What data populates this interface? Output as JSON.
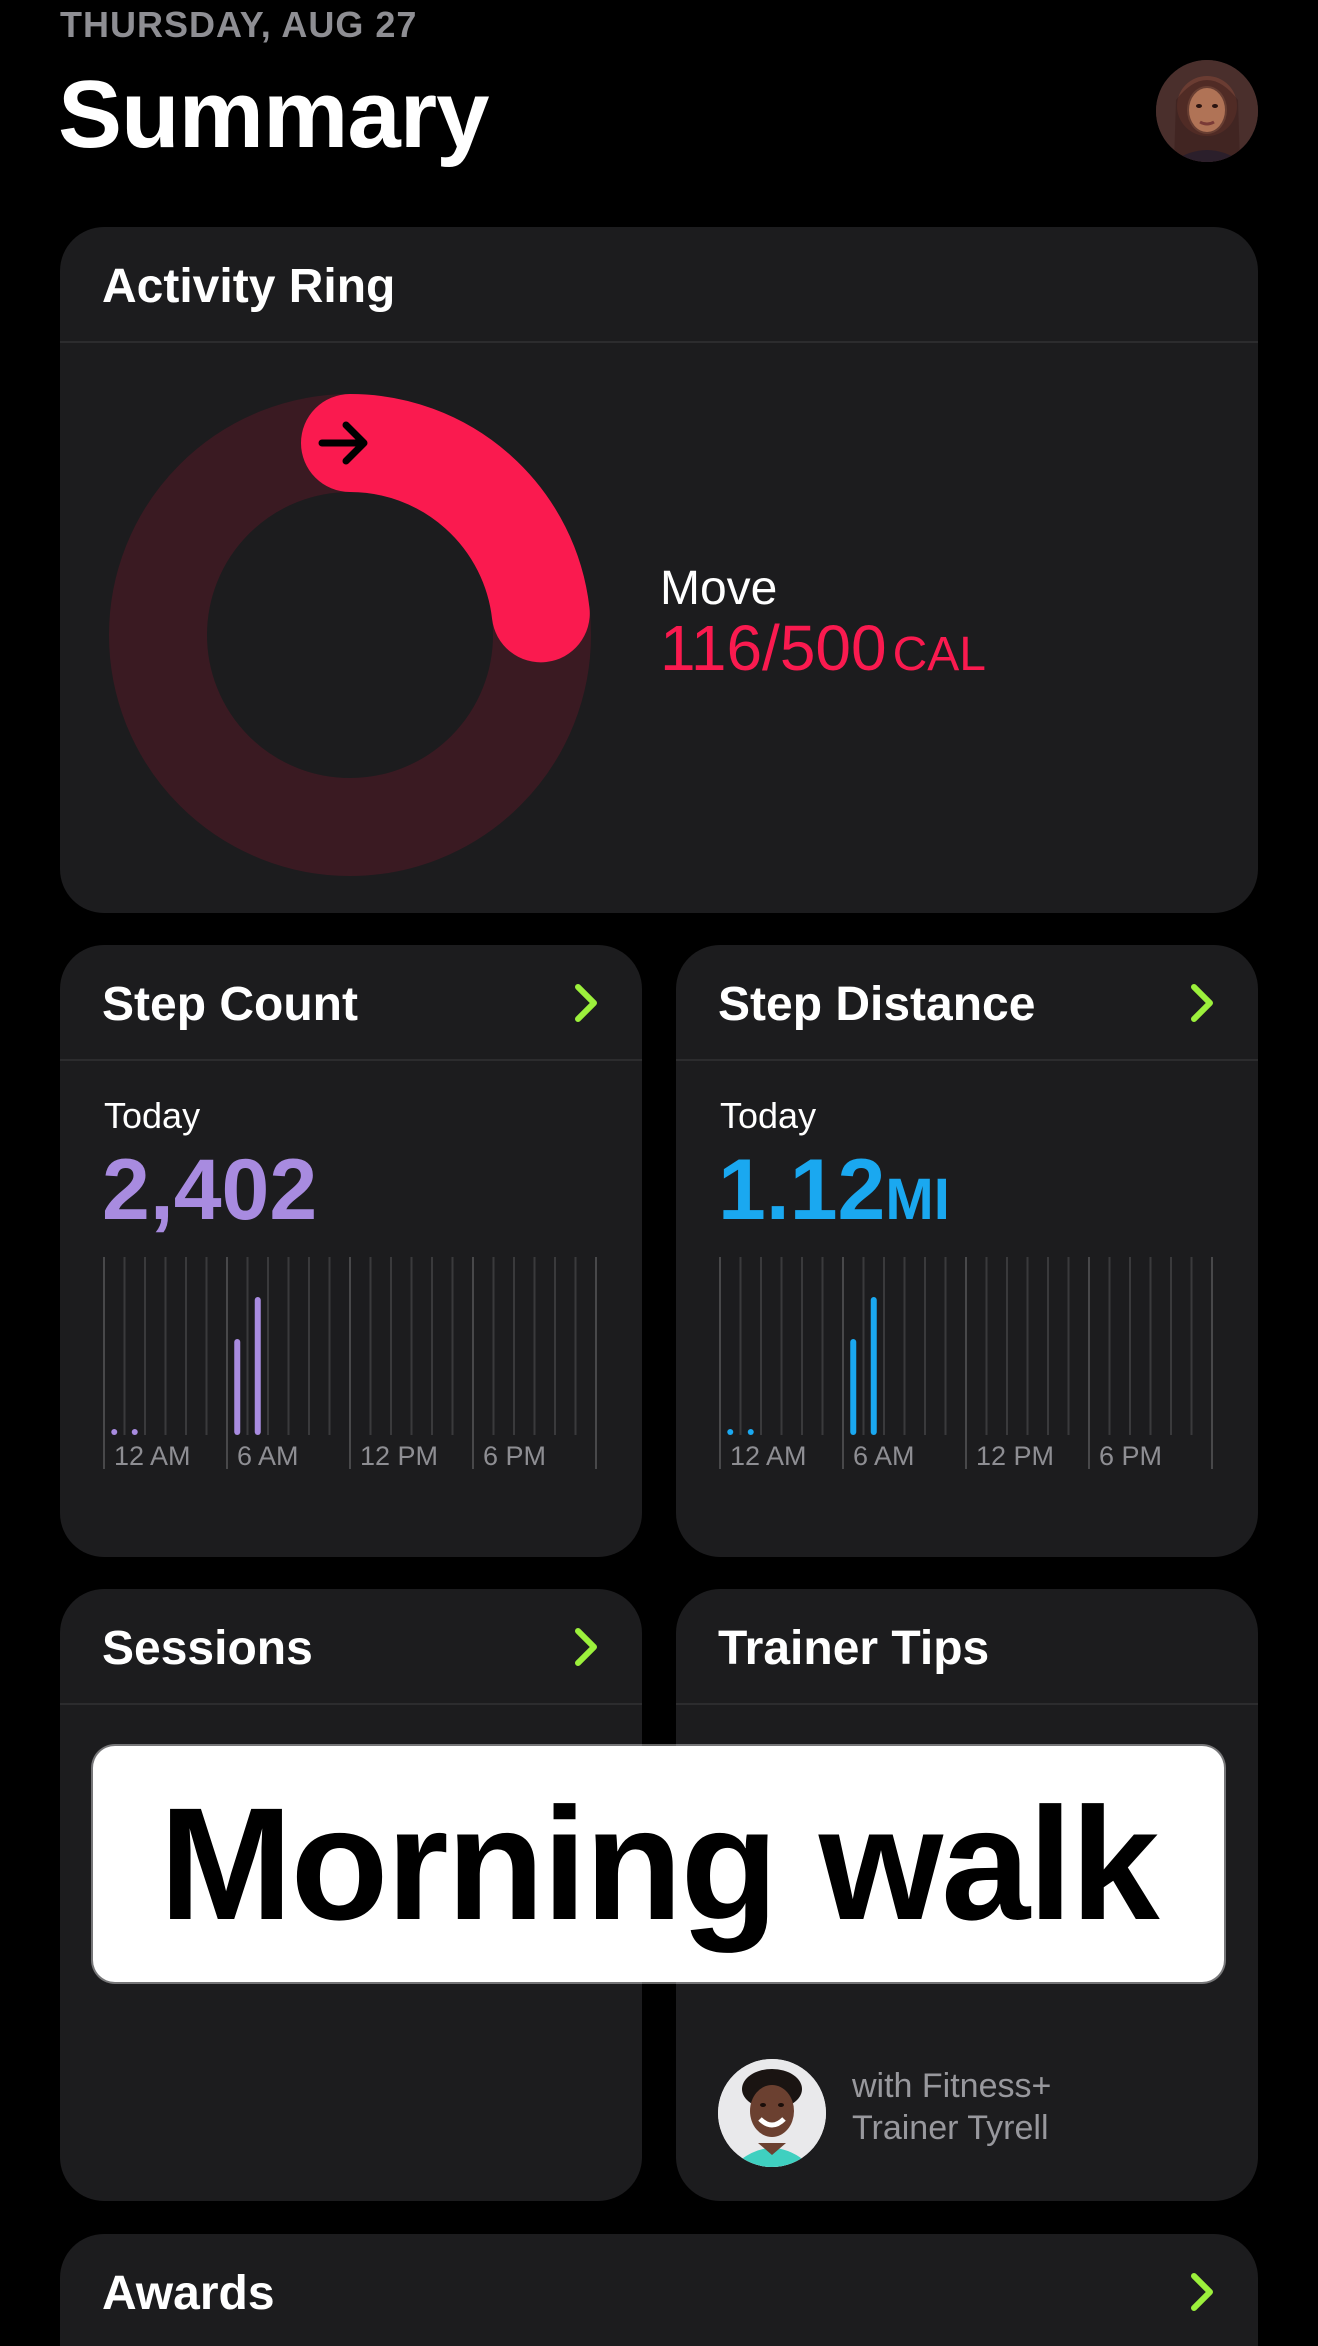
{
  "header": {
    "date": "THURSDAY, AUG 27",
    "title": "Summary"
  },
  "activity_ring": {
    "title": "Activity Ring",
    "move_label": "Move",
    "move_value": "116/500",
    "move_unit": "CAL",
    "progress": 0.232,
    "color": "#fa1a4f",
    "track_color": "#3a1a22"
  },
  "step_count": {
    "title": "Step Count",
    "today_label": "Today",
    "value": "2,402",
    "color": "#a88be0"
  },
  "step_distance": {
    "title": "Step Distance",
    "today_label": "Today",
    "value": "1.12",
    "unit": "MI",
    "color": "#1aa8f0"
  },
  "chart_axis": {
    "ticks": [
      "12 AM",
      "6 AM",
      "12 PM",
      "6 PM"
    ]
  },
  "sessions": {
    "title": "Sessions"
  },
  "trainer_tips": {
    "title": "Trainer Tips",
    "trainer_line1": "with Fitness+",
    "trainer_line2": "Trainer Tyrell"
  },
  "awards": {
    "title": "Awards"
  },
  "overlay": {
    "text": "Morning walk"
  },
  "accent_color": "#9cf03c"
}
